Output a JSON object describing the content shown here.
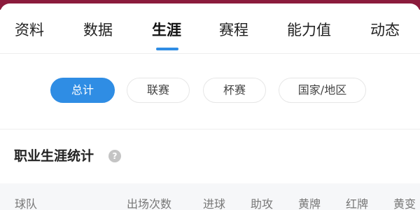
{
  "tabs": [
    {
      "label": "资料"
    },
    {
      "label": "数据"
    },
    {
      "label": "生涯"
    },
    {
      "label": "赛程"
    },
    {
      "label": "能力值"
    },
    {
      "label": "动态"
    }
  ],
  "active_tab": "生涯",
  "filters": [
    {
      "label": "总计"
    },
    {
      "label": "联赛"
    },
    {
      "label": "杯赛"
    },
    {
      "label": "国家/地区"
    }
  ],
  "active_filter": "总计",
  "section": {
    "title": "职业生涯统计",
    "help_glyph": "?"
  },
  "table": {
    "columns": [
      "球队",
      "出场次数",
      "进球",
      "助攻",
      "黄牌",
      "红牌",
      "黄变"
    ]
  },
  "colors": {
    "accent": "#2f8de4",
    "header_band": "#8b1b3c"
  },
  "icons": [
    "help-icon"
  ]
}
